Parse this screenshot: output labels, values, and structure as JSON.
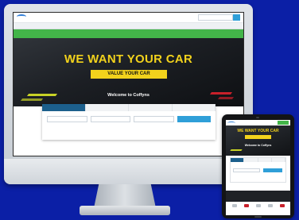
{
  "desktop": {
    "search_placeholder": "",
    "hero": {
      "title": "WE WANT YOUR CAR",
      "cta": "VALUE YOUR CAR",
      "welcome": "Welcome to Coffyns"
    }
  },
  "tablet": {
    "hero": {
      "title": "WE WANT YOUR CAR",
      "welcome": "Welcome to Coffyns"
    }
  },
  "colors": {
    "background": "#0b1fa6",
    "accent_yellow": "#f2d21c",
    "promo_green": "#43b549",
    "tab_blue": "#1c5f8c",
    "button_blue": "#2f9fd8"
  }
}
